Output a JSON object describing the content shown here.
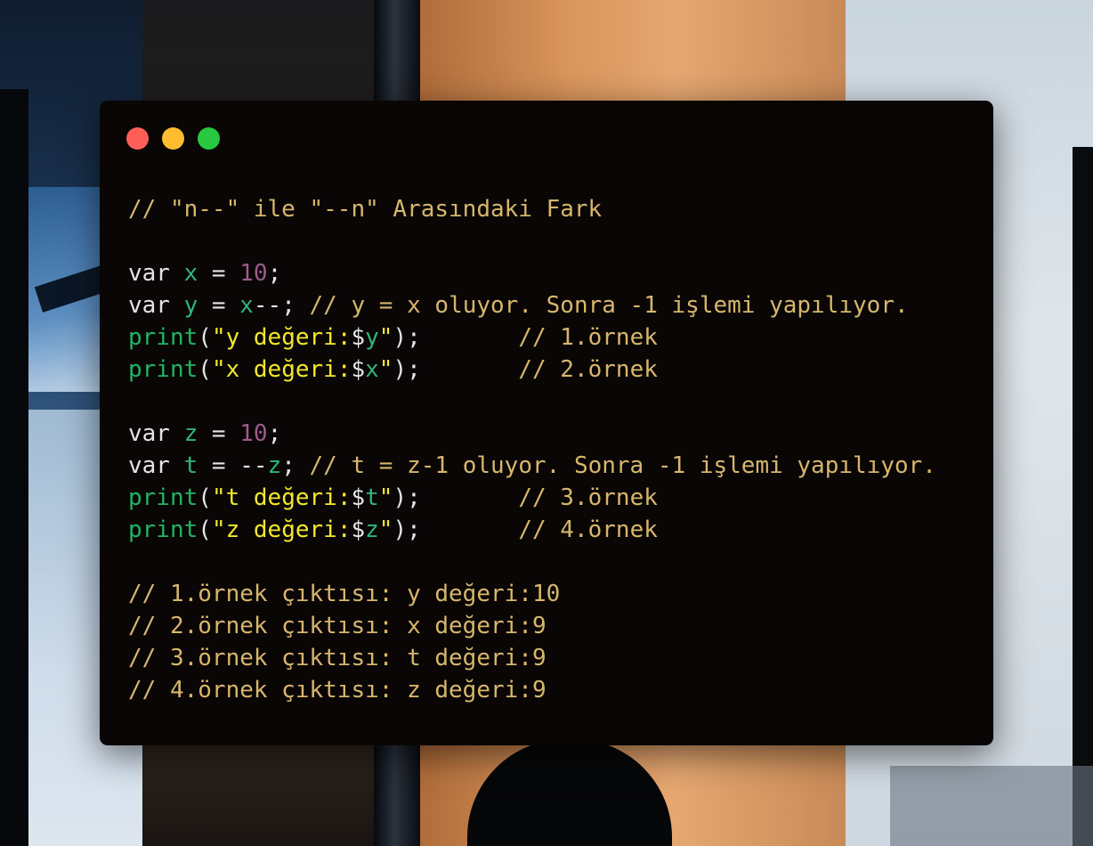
{
  "window": {
    "controls": {
      "close": "close-button",
      "minimize": "minimize-button",
      "zoom": "zoom-button"
    }
  },
  "colors": {
    "background": "#090605",
    "keyword": "#e4e4e4",
    "variable": "#2fb57a",
    "number": "#9f5a8f",
    "comment": "#d7b66c",
    "function": "#21b564",
    "string": "#f3e72c",
    "close": "#ff5f57",
    "minimize": "#febc2e",
    "zoom": "#28c840"
  },
  "code": {
    "lines": [
      [
        {
          "t": "c",
          "v": "// \"n--\" ile \"--n\" Arasındaki Fark"
        }
      ],
      [],
      [
        {
          "t": "k",
          "v": "var "
        },
        {
          "t": "v",
          "v": "x"
        },
        {
          "t": "p",
          "v": " = "
        },
        {
          "t": "n",
          "v": "10"
        },
        {
          "t": "p",
          "v": ";"
        }
      ],
      [
        {
          "t": "k",
          "v": "var "
        },
        {
          "t": "v",
          "v": "y"
        },
        {
          "t": "p",
          "v": " = "
        },
        {
          "t": "v",
          "v": "x"
        },
        {
          "t": "p",
          "v": "--; "
        },
        {
          "t": "c",
          "v": "// y = x oluyor. Sonra -1 işlemi yapılıyor."
        }
      ],
      [
        {
          "t": "f",
          "v": "print"
        },
        {
          "t": "p",
          "v": "("
        },
        {
          "t": "s",
          "v": "\"y değeri:"
        },
        {
          "t": "p",
          "v": "$"
        },
        {
          "t": "v",
          "v": "y"
        },
        {
          "t": "s",
          "v": "\""
        },
        {
          "t": "p",
          "v": ");       "
        },
        {
          "t": "c",
          "v": "// 1.örnek"
        }
      ],
      [
        {
          "t": "f",
          "v": "print"
        },
        {
          "t": "p",
          "v": "("
        },
        {
          "t": "s",
          "v": "\"x değeri:"
        },
        {
          "t": "p",
          "v": "$"
        },
        {
          "t": "v",
          "v": "x"
        },
        {
          "t": "s",
          "v": "\""
        },
        {
          "t": "p",
          "v": ");       "
        },
        {
          "t": "c",
          "v": "// 2.örnek"
        }
      ],
      [],
      [
        {
          "t": "k",
          "v": "var "
        },
        {
          "t": "v",
          "v": "z"
        },
        {
          "t": "p",
          "v": " = "
        },
        {
          "t": "n",
          "v": "10"
        },
        {
          "t": "p",
          "v": ";"
        }
      ],
      [
        {
          "t": "k",
          "v": "var "
        },
        {
          "t": "v",
          "v": "t"
        },
        {
          "t": "p",
          "v": " = --"
        },
        {
          "t": "v",
          "v": "z"
        },
        {
          "t": "p",
          "v": "; "
        },
        {
          "t": "c",
          "v": "// t = z-1 oluyor. Sonra -1 işlemi yapılıyor."
        }
      ],
      [
        {
          "t": "f",
          "v": "print"
        },
        {
          "t": "p",
          "v": "("
        },
        {
          "t": "s",
          "v": "\"t değeri:"
        },
        {
          "t": "p",
          "v": "$"
        },
        {
          "t": "v",
          "v": "t"
        },
        {
          "t": "s",
          "v": "\""
        },
        {
          "t": "p",
          "v": ");       "
        },
        {
          "t": "c",
          "v": "// 3.örnek"
        }
      ],
      [
        {
          "t": "f",
          "v": "print"
        },
        {
          "t": "p",
          "v": "("
        },
        {
          "t": "s",
          "v": "\"z değeri:"
        },
        {
          "t": "p",
          "v": "$"
        },
        {
          "t": "v",
          "v": "z"
        },
        {
          "t": "s",
          "v": "\""
        },
        {
          "t": "p",
          "v": ");       "
        },
        {
          "t": "c",
          "v": "// 4.örnek"
        }
      ],
      [],
      [
        {
          "t": "c",
          "v": "// 1.örnek çıktısı: y değeri:10"
        }
      ],
      [
        {
          "t": "c",
          "v": "// 2.örnek çıktısı: x değeri:9"
        }
      ],
      [
        {
          "t": "c",
          "v": "// 3.örnek çıktısı: t değeri:9"
        }
      ],
      [
        {
          "t": "c",
          "v": "// 4.örnek çıktısı: z değeri:9"
        }
      ]
    ]
  }
}
